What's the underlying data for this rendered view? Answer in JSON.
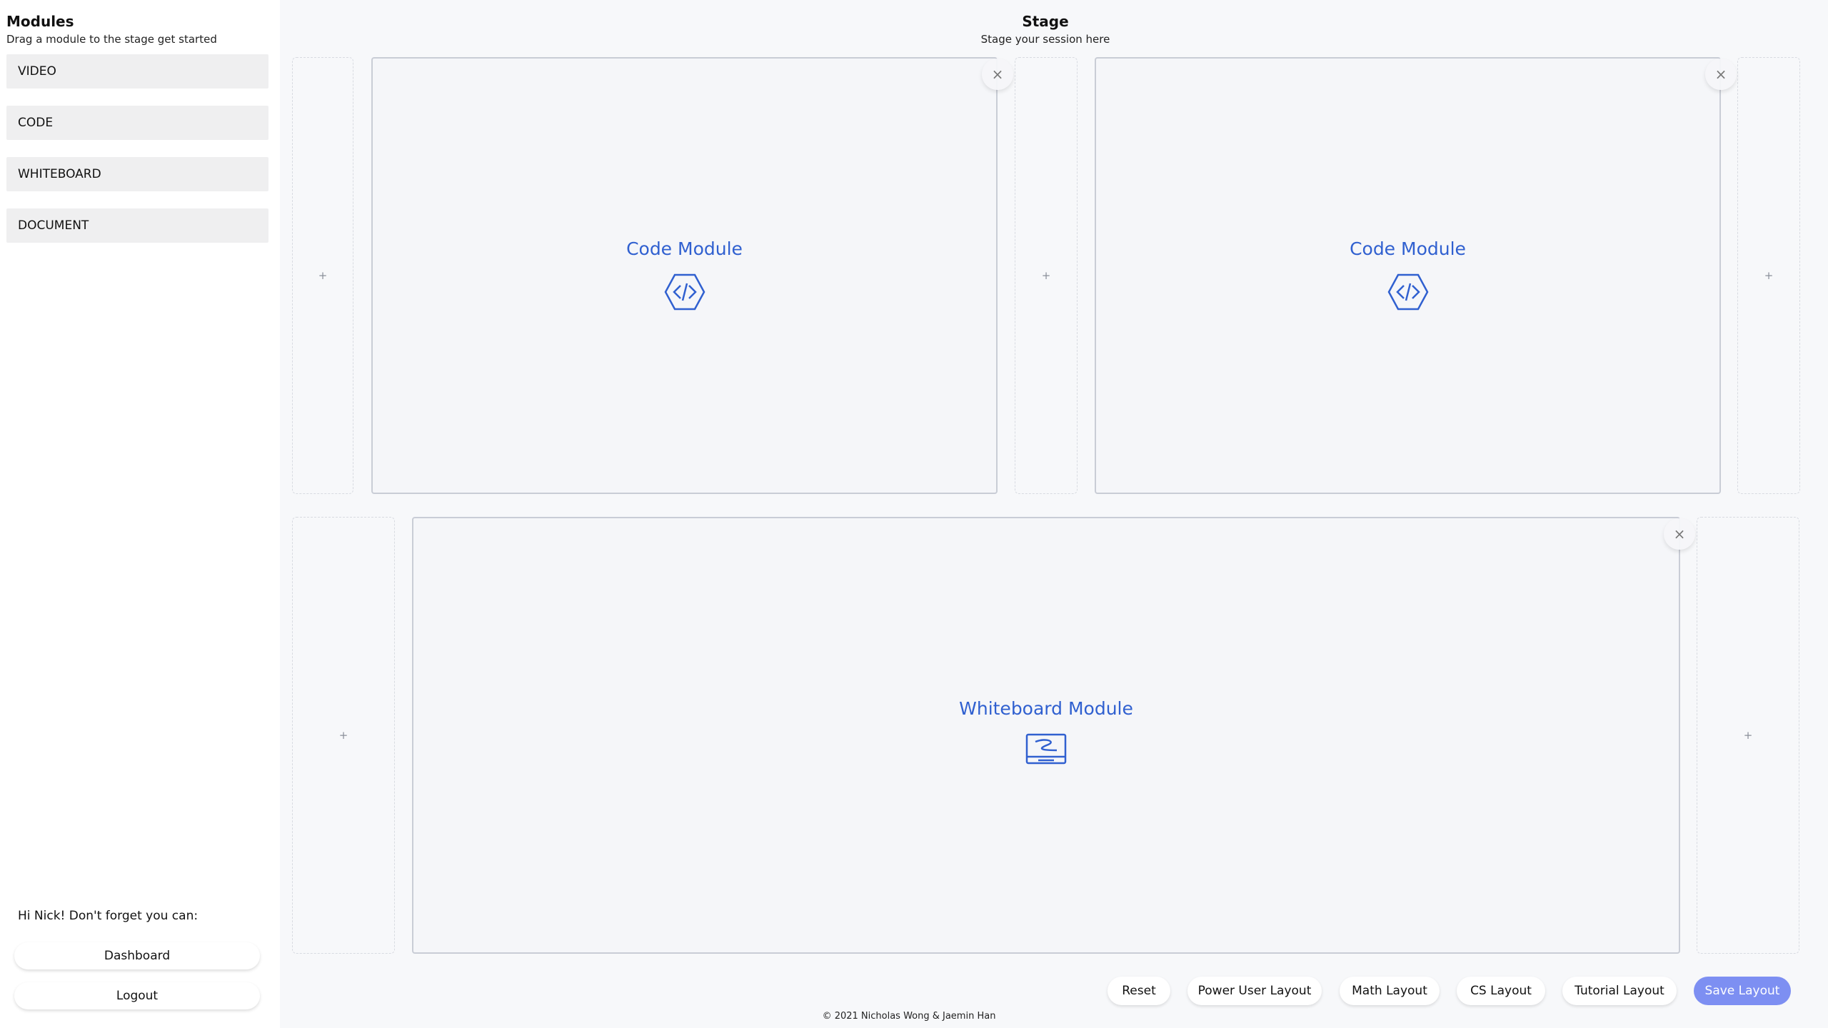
{
  "sidebar": {
    "title": "Modules",
    "subtitle": "Drag a module to the stage get started",
    "modules": [
      {
        "label": "VIDEO"
      },
      {
        "label": "CODE"
      },
      {
        "label": "WHITEBOARD"
      },
      {
        "label": "DOCUMENT"
      }
    ],
    "greeting": "Hi Nick! Don't forget you can:",
    "dashboard_label": "Dashboard",
    "logout_label": "Logout"
  },
  "stage": {
    "title": "Stage",
    "subtitle": "Stage your session here",
    "add_symbol": "+",
    "close_symbol": "×",
    "cards": [
      {
        "label": "Code Module",
        "icon": "code-icon"
      },
      {
        "label": "Code Module",
        "icon": "code-icon"
      },
      {
        "label": "Whiteboard Module",
        "icon": "whiteboard-icon"
      }
    ]
  },
  "actions": {
    "reset": "Reset",
    "power_user": "Power User Layout",
    "math": "Math Layout",
    "cs": "CS Layout",
    "tutorial": "Tutorial Layout",
    "save": "Save Layout"
  },
  "footer": "© 2021 Nicholas Wong & Jaemin Han",
  "colors": {
    "accent": "#3060d0",
    "primary_button": "#7d8ff2",
    "stage_background": "#f7f8fa"
  }
}
